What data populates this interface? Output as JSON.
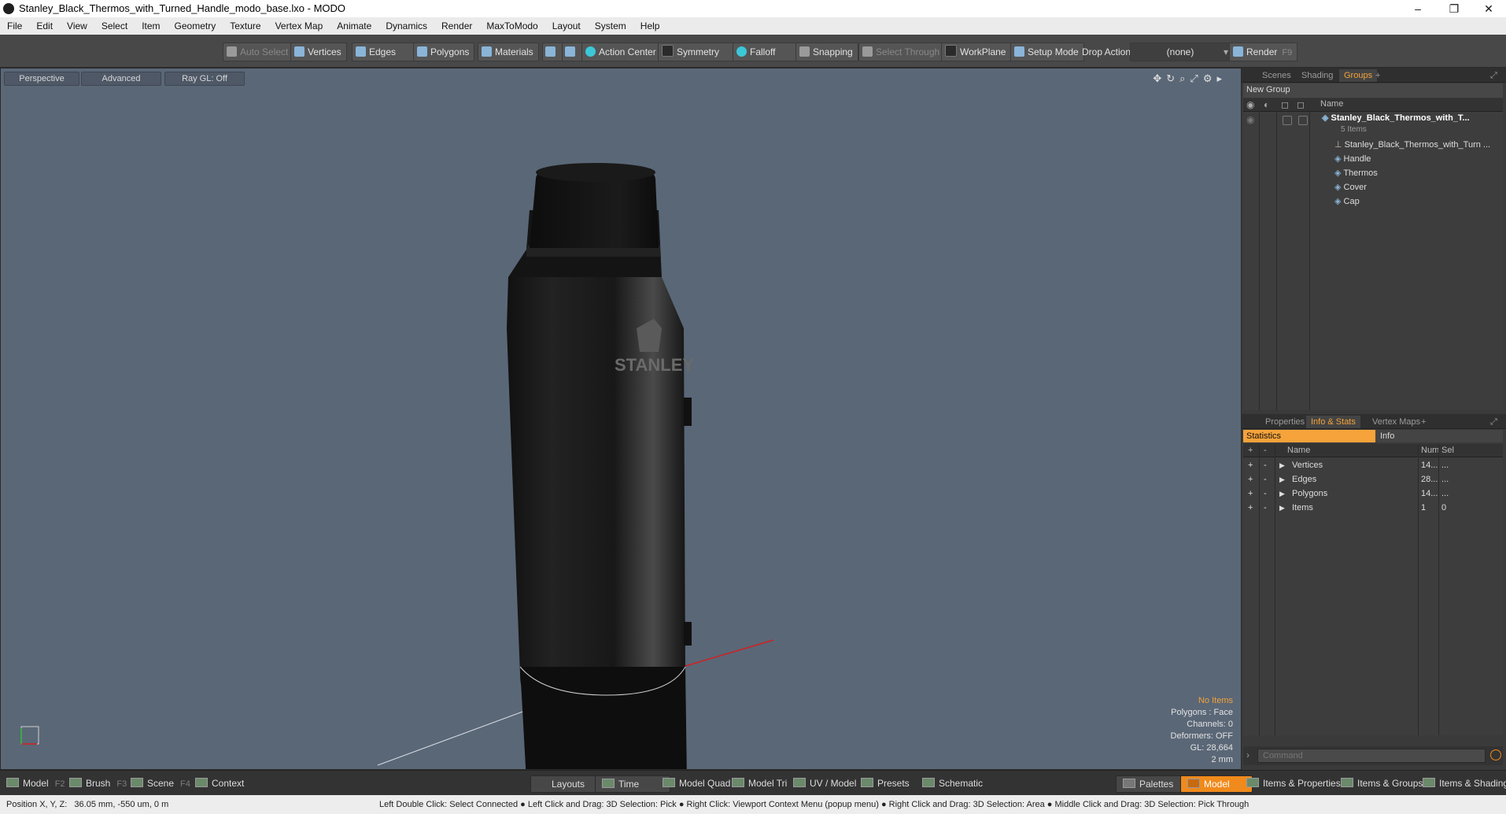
{
  "window": {
    "title": "Stanley_Black_Thermos_with_Turned_Handle_modo_base.lxo - MODO",
    "minimize": "–",
    "maximize": "❐",
    "close": "✕"
  },
  "menu": [
    "File",
    "Edit",
    "View",
    "Select",
    "Item",
    "Geometry",
    "Texture",
    "Vertex Map",
    "Animate",
    "Dynamics",
    "Render",
    "MaxToModo",
    "Layout",
    "System",
    "Help"
  ],
  "toolbar": {
    "auto_select": "Auto Select",
    "vertices": "Vertices",
    "edges": "Edges",
    "polygons": "Polygons",
    "materials": "Materials",
    "action_center": "Action Center",
    "symmetry": "Symmetry",
    "falloff": "Falloff",
    "snapping": "Snapping",
    "select_through": "Select Through",
    "workplane": "WorkPlane",
    "setup_mode": "Setup Mode",
    "drop_action": "Drop Action",
    "drop_value": "(none)",
    "render": "Render",
    "render_key": "F9"
  },
  "viewport": {
    "view_mode": "Perspective",
    "shading": "Advanced",
    "raygl": "Ray GL: Off",
    "brand_text": "STANLEY",
    "stats": {
      "no_items": "No Items",
      "polygons": "Polygons : Face",
      "channels": "Channels: 0",
      "deformers": "Deformers: OFF",
      "gl": "GL: 28,664",
      "scale": "2 mm"
    }
  },
  "scene_panel": {
    "tabs": [
      "Scenes",
      "Shading",
      "Groups"
    ],
    "active_tab": "Groups",
    "new_group": "New Group",
    "column_name": "Name",
    "root": {
      "name": "Stanley_Black_Thermos_with_T...",
      "count": "5 Items"
    },
    "children": [
      "Stanley_Black_Thermos_with_Turn ...",
      "Handle",
      "Thermos",
      "Cover",
      "Cap"
    ]
  },
  "info_panel": {
    "tabs": [
      "Properties",
      "Info & Stats",
      "Vertex Maps"
    ],
    "active_tab": "Info & Stats",
    "subtabs": [
      "Statistics",
      "Info"
    ],
    "columns": {
      "name": "Name",
      "num": "Num",
      "sel": "Sel"
    },
    "rows": [
      {
        "name": "Vertices",
        "num": "14...",
        "sel": "..."
      },
      {
        "name": "Edges",
        "num": "28...",
        "sel": "..."
      },
      {
        "name": "Polygons",
        "num": "14...",
        "sel": "..."
      },
      {
        "name": "Items",
        "num": "1",
        "sel": "0"
      }
    ],
    "command_placeholder": "Command"
  },
  "bottom_bar": {
    "model": "Model",
    "model_key": "F2",
    "brush": "Brush",
    "brush_key": "F3",
    "scene": "Scene",
    "scene_key": "F4",
    "context": "Context",
    "layouts": "Layouts",
    "time": "Time",
    "model_quad": "Model Quad",
    "model_tri": "Model Tri",
    "uv_model": "UV / Model",
    "presets": "Presets",
    "schematic": "Schematic",
    "palettes": "Palettes",
    "model_active": "Model",
    "items_properties": "Items & Properties",
    "items_groups": "Items & Groups",
    "items_shading": "Items & Shading"
  },
  "status": {
    "position": "Position X, Y, Z:   36.05 mm, -550 um, 0 m",
    "hints": "Left Double Click: Select Connected ● Left Click and Drag: 3D Selection: Pick ● Right Click: Viewport Context Menu (popup menu) ● Right Click and Drag: 3D Selection: Area ● Middle Click and Drag: 3D Selection: Pick Through"
  }
}
